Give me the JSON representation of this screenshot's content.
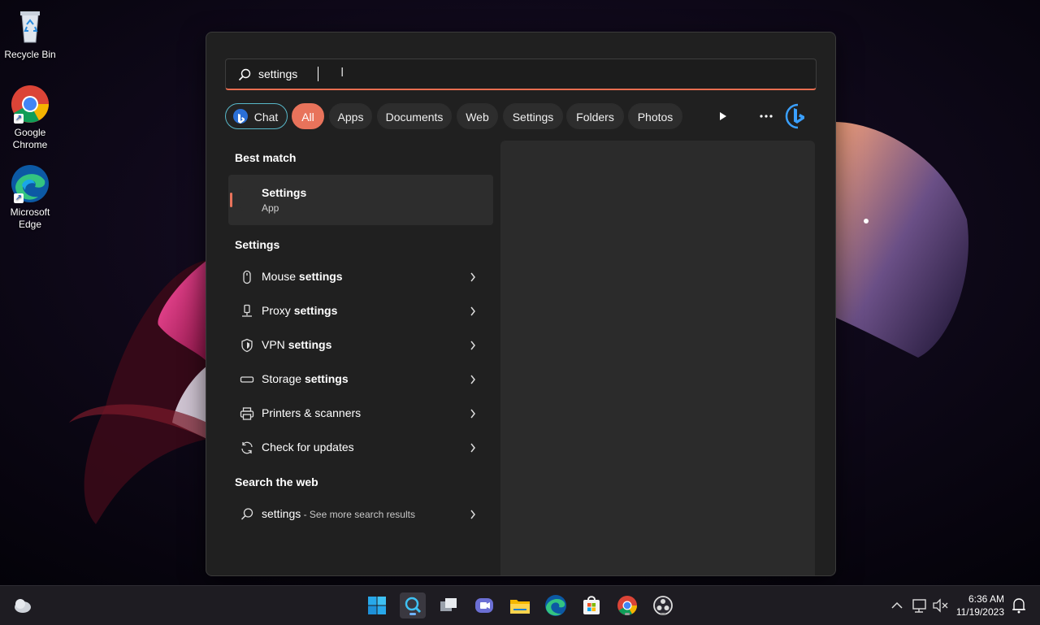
{
  "desktop": {
    "icons": [
      {
        "label": "Recycle Bin"
      },
      {
        "label": "Google Chrome"
      },
      {
        "label": "Microsoft Edge"
      }
    ]
  },
  "search": {
    "query": "settings",
    "filters": {
      "chat": "Chat",
      "all": "All",
      "apps": "Apps",
      "documents": "Documents",
      "web": "Web",
      "settings": "Settings",
      "folders": "Folders",
      "photos": "Photos"
    },
    "best_match_title": "Best match",
    "best_match": {
      "name": "Settings",
      "type": "App"
    },
    "settings_section_title": "Settings",
    "settings_results": [
      {
        "prefix": "Mouse ",
        "bold": "settings",
        "icon": "mouse-icon"
      },
      {
        "prefix": "Proxy ",
        "bold": "settings",
        "icon": "proxy-icon"
      },
      {
        "prefix": "VPN ",
        "bold": "settings",
        "icon": "shield-icon"
      },
      {
        "prefix": "Storage ",
        "bold": "settings",
        "icon": "storage-icon"
      },
      {
        "prefix": "Printers & scanners",
        "bold": "",
        "icon": "printer-icon"
      },
      {
        "prefix": "Check for updates",
        "bold": "",
        "icon": "refresh-icon"
      }
    ],
    "web_section_title": "Search the web",
    "web_result": {
      "query": "settings",
      "suffix": " - See more search results"
    }
  },
  "taskbar": {
    "time": "6:36 AM",
    "date": "11/19/2023"
  },
  "colors": {
    "accent": "#e8735b",
    "panel": "#202020",
    "chip": "#2d2d2d"
  }
}
